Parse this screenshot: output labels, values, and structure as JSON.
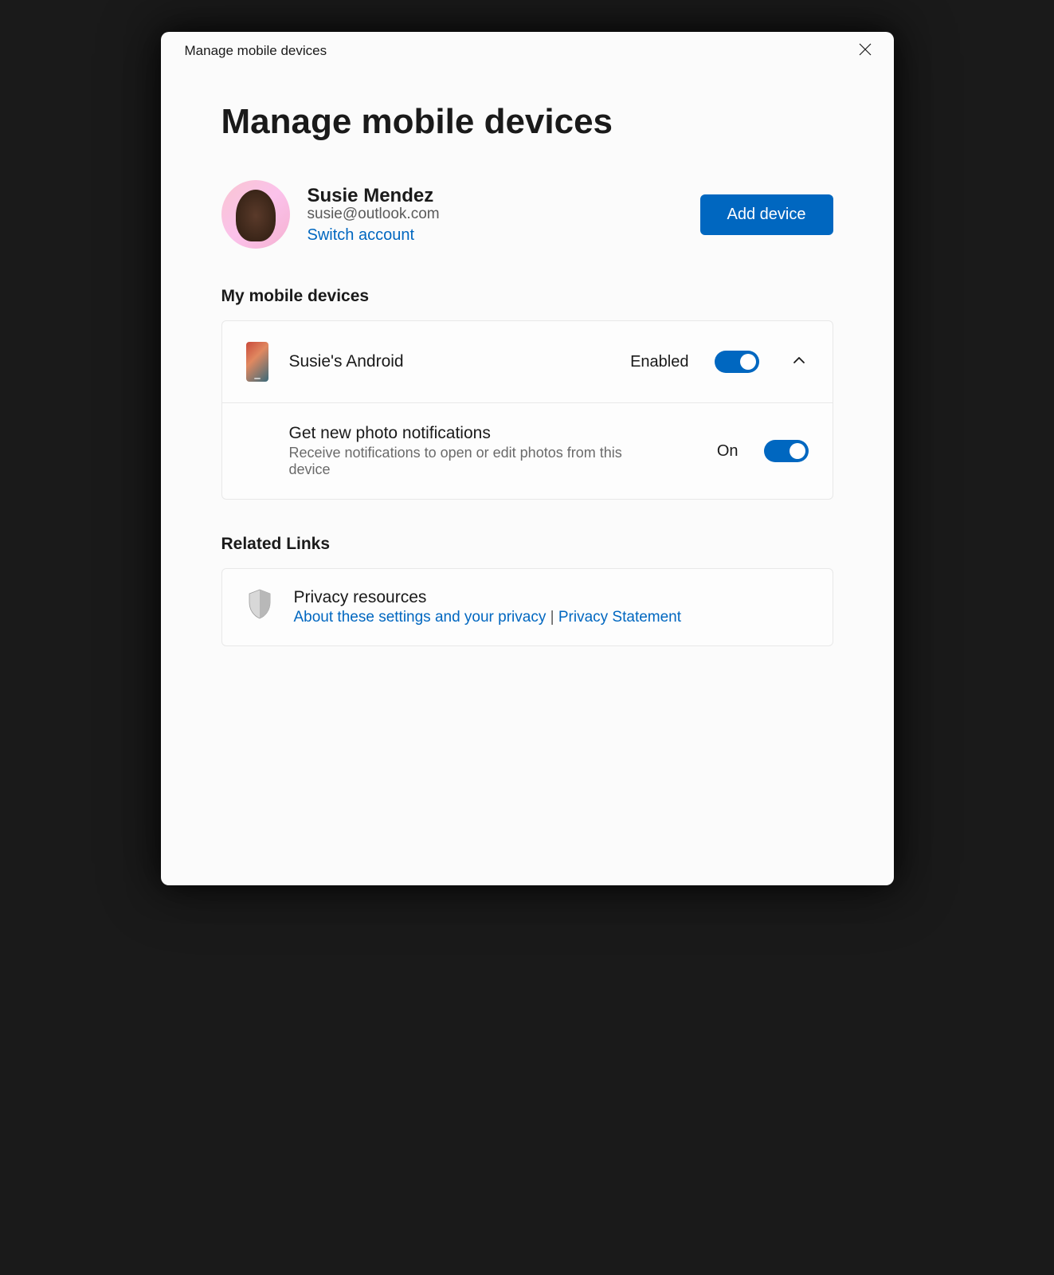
{
  "titlebar": {
    "title": "Manage mobile devices"
  },
  "page": {
    "title": "Manage mobile devices"
  },
  "user": {
    "name": "Susie Mendez",
    "email": "susie@outlook.com",
    "switch_label": "Switch account"
  },
  "actions": {
    "add_device": "Add device"
  },
  "devices_section": {
    "heading": "My mobile devices"
  },
  "device": {
    "name": "Susie's Android",
    "status": "Enabled",
    "setting": {
      "title": "Get new photo notifications",
      "desc": "Receive notifications to open or edit photos from this device",
      "status": "On"
    }
  },
  "related": {
    "heading": "Related Links",
    "privacy_title": "Privacy resources",
    "link1": "About these settings and your privacy",
    "separator": " | ",
    "link2": "Privacy Statement"
  },
  "colors": {
    "accent": "#0067c0"
  }
}
